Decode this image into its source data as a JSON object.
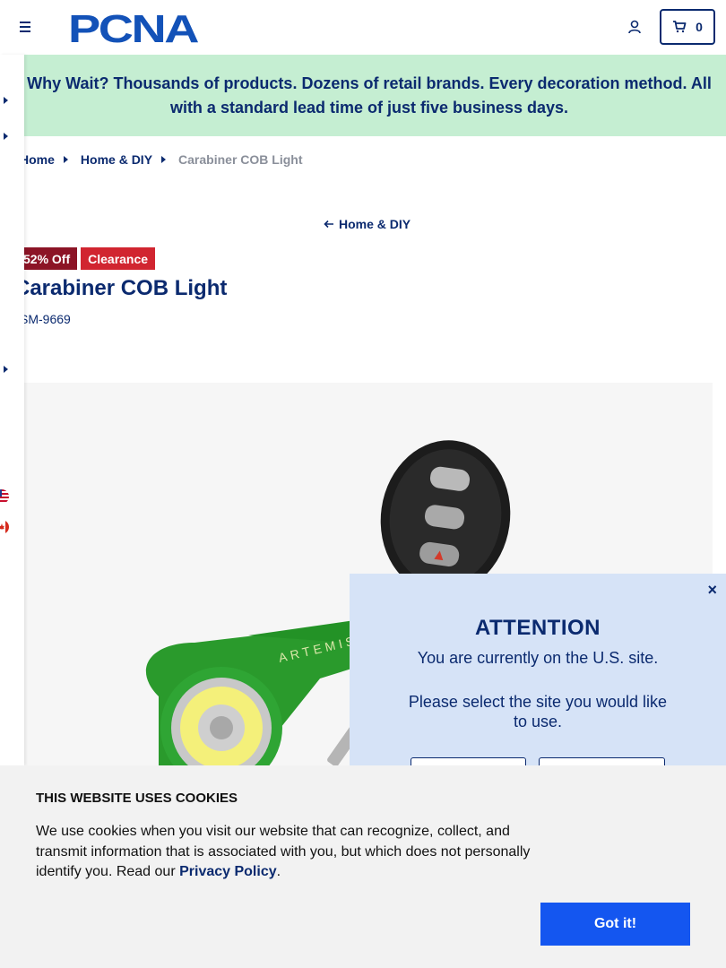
{
  "header": {
    "logo_text": "PCNA",
    "cart_count": "0"
  },
  "promo": {
    "text": "Why Wait? Thousands of products. Dozens of retail brands. Every decoration method. All with a standard lead time of just five business days."
  },
  "breadcrumb": {
    "items": [
      "Home",
      "Home & DIY"
    ],
    "current": "Carabiner COB Light"
  },
  "back_link": "Home & DIY",
  "product": {
    "badges": [
      "52% Off",
      "Clearance"
    ],
    "title": "Carabiner COB Light",
    "sku": "SM-9669",
    "image_brand_text": "ARTEMIS"
  },
  "modal": {
    "title": "ATTENTION",
    "line1": "You are currently on the U.S. site.",
    "line2": "Please select the site you would like to use.",
    "close_label": "×"
  },
  "cookie": {
    "title": "THIS WEBSITE USES COOKIES",
    "text_before": "We use cookies when you visit our website that can recognize, collect, and transmit information that is associated with you, but which does not personally identify you. Read our ",
    "link": "Privacy Policy",
    "text_after": ".",
    "button": "Got it!"
  },
  "colors": {
    "navy": "#0b2a6f",
    "promo_bg": "#c5eed2",
    "badge_off": "#8c1426",
    "badge_clearance": "#d12530",
    "modal_bg": "#d6e3f7",
    "cookie_button": "#1456f0"
  },
  "icons": [
    "hamburger-icon",
    "account-icon",
    "cart-icon",
    "caret-right-icon",
    "arrow-left-icon",
    "us-flag-icon",
    "canada-flag-icon",
    "close-icon"
  ]
}
